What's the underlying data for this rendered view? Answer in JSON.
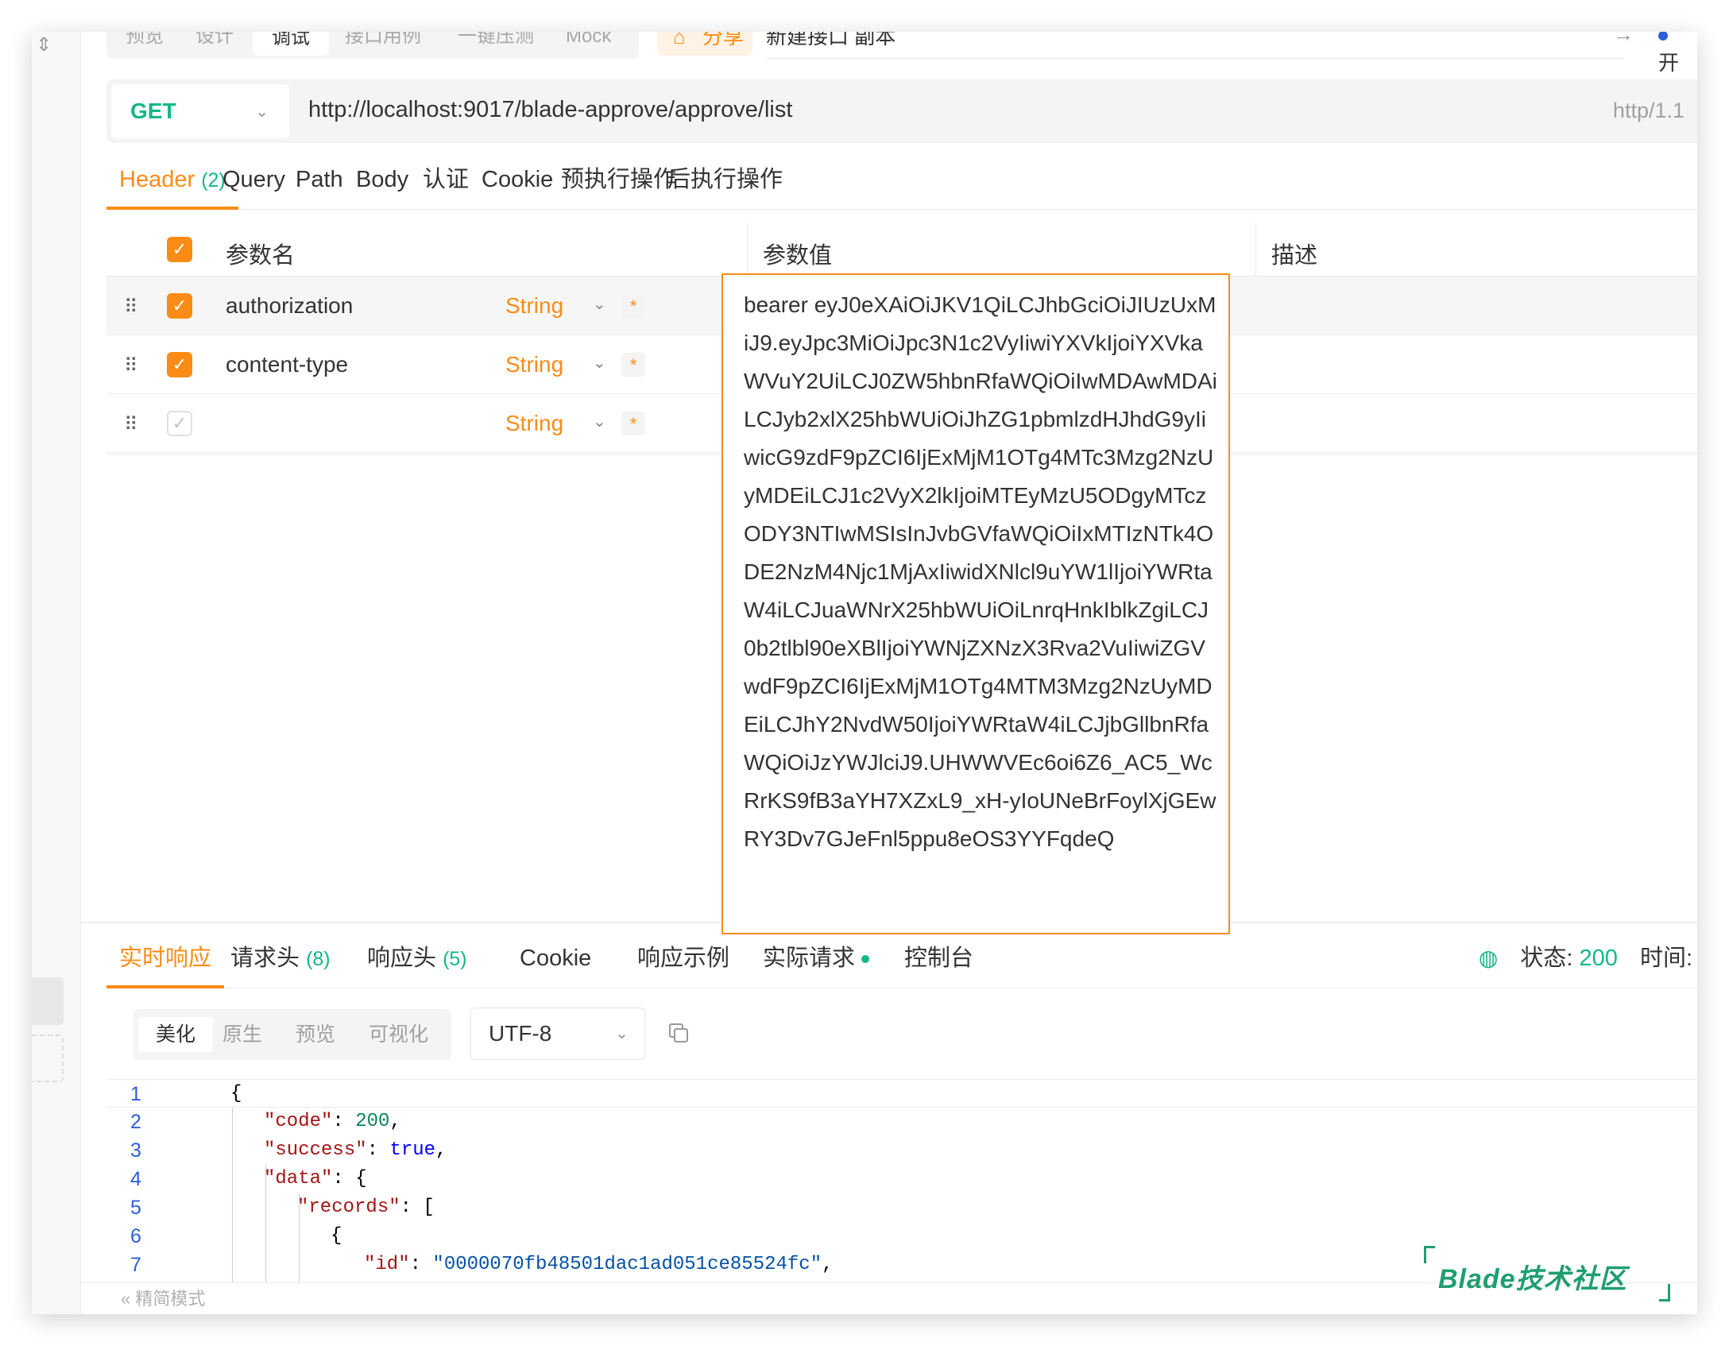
{
  "top_tabs": {
    "items": [
      "预览",
      "设计",
      "调试",
      "接口用例",
      "一键压测",
      "Mock"
    ],
    "active": "调试",
    "share_label": "分享",
    "api_name": "新建接口 副本",
    "status_label": "开发中",
    "status_color": "#2b5fd9"
  },
  "request": {
    "method": "GET",
    "method_color": "#12b886",
    "url": "http://localhost:9017/blade-approve/approve/list",
    "protocol": "http/1.1"
  },
  "request_tabs": {
    "header_label": "Header",
    "header_count": "(2)",
    "items": [
      "Query",
      "Path",
      "Body",
      "认证",
      "Cookie",
      "预执行操作",
      "后执行操作"
    ]
  },
  "param_table": {
    "col_name": "参数名",
    "col_value": "参数值",
    "col_desc": "描述",
    "rows": [
      {
        "name": "authorization",
        "type": "String",
        "required": "*",
        "checked": true
      },
      {
        "name": "content-type",
        "type": "String",
        "required": "*",
        "checked": true
      },
      {
        "name": "",
        "type": "String",
        "required": "*",
        "checked": false
      }
    ],
    "editing_value": "bearer eyJ0eXAiOiJKV1QiLCJhbGciOiJIUzUxMiJ9.eyJpc3MiOiJpc3N1c2VyIiwiYXVkIjoiYXVkaWVuY2UiLCJ0ZW5hbnRfaWQiOiIwMDAwMDAiLCJyb2xlX25hbWUiOiJhZG1pbmlzdHJhdG9yIiwicG9zdF9pZCI6IjExMjM1OTg4MTc3Mzg2NzUyMDEiLCJ1c2VyX2lkIjoiMTEyMzU5ODgyMTczODY3NTIwMSIsInJvbGVfaWQiOiIxMTIzNTk4ODE2NzM4Njc1MjAxIiwidXNlcl9uYW1lIjoiYWRtaW4iLCJuaWNrX25hbWUiOiLnrqHnkIblkZgiLCJ0b2tlbl90eXBlIjoiYWNjZXNzX3Rva2VuIiwiZGVwdF9pZCI6IjExMjM1OTg4MTM3Mzg2NzUyMDEiLCJhY2NvdW50IjoiYWRtaW4iLCJjbGllbnRfaWQiOiJzYWJlciJ9.UHWWVEc6oi6Z6_AC5_WcRrKS9fB3aYH7XZxL9_xH-yIoUNeBrFoylXjGEwRY3Dv7GJeFnl5ppu8eOS3YYFqdeQ"
  },
  "response_tabs": {
    "active": "实时响应",
    "req_headers": "请求头",
    "req_headers_count": "(8)",
    "resp_headers": "响应头",
    "resp_headers_count": "(5)",
    "cookie": "Cookie",
    "example": "响应示例",
    "actual": "实际请求",
    "console": "控制台",
    "status_label": "状态:",
    "status_value": "200",
    "time_label": "时间:"
  },
  "response_view": {
    "modes": [
      "美化",
      "原生",
      "预览",
      "可视化"
    ],
    "active_mode": "美化",
    "encoding": "UTF-8"
  },
  "response_body": {
    "line_numbers": [
      "1",
      "2",
      "3",
      "4",
      "5",
      "6",
      "7"
    ],
    "open_brace": "{",
    "code_key": "\"code\"",
    "code_value": "200",
    "success_key": "\"success\"",
    "success_value": "true",
    "data_key": "\"data\"",
    "records_key": "\"records\"",
    "id_key": "\"id\"",
    "id_value": "\"0000070fb48501dac1ad051ce85524fc\""
  },
  "footer": {
    "text": "« 精简模式"
  },
  "watermark": {
    "text": "Blade技术社区"
  }
}
